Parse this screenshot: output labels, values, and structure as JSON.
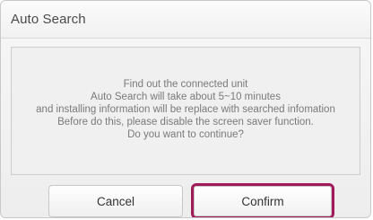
{
  "dialog": {
    "title": "Auto Search",
    "message_lines": [
      "Find out the connected unit",
      "Auto Search will take about 5~10 minutes",
      "and installing information will be replace with searched infomation",
      "Before do this, please disable the screen saver function.",
      "Do you want to continue?"
    ],
    "buttons": {
      "cancel_label": "Cancel",
      "confirm_label": "Confirm"
    },
    "colors": {
      "confirm_highlight": "#a31a5a",
      "title_text": "#4a4a4a",
      "message_text": "#7a7a7a"
    }
  }
}
